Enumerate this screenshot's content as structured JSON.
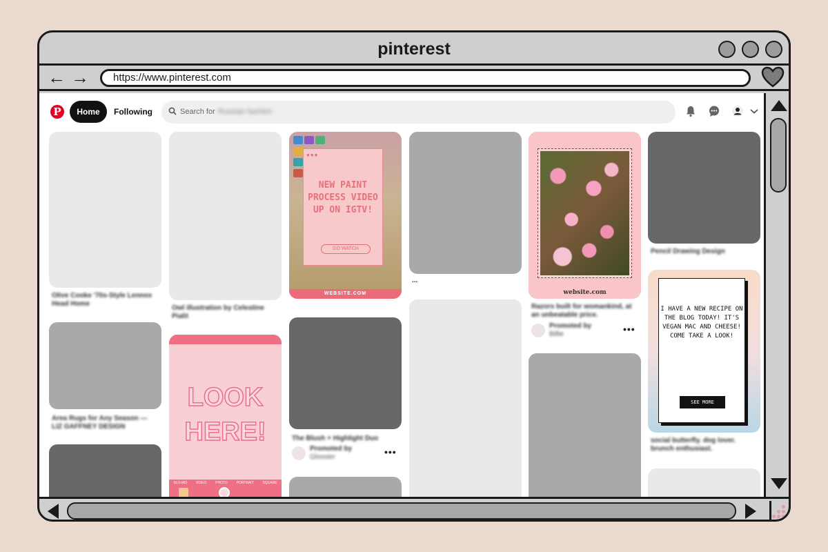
{
  "window": {
    "title": "pinterest",
    "url": "https://www.pinterest.com"
  },
  "header": {
    "logo": "P",
    "home_label": "Home",
    "following_label": "Following",
    "search_placeholder": "Search for",
    "search_query": "Russian fashion"
  },
  "pins": {
    "paint": {
      "dots": "●●●",
      "text": "NEW PAINT PROCESS VIDEO UP ON IGTV!",
      "button": "GO WATCH",
      "footer": "WEBSITE.COM"
    },
    "flowers": {
      "web_label": "website.com",
      "caption": "Razors built for womankind, at an unbeatable price.",
      "promoted_label": "Promoted by",
      "promoter": "Billie"
    },
    "look": {
      "text": "LOOK HERE!",
      "modes": [
        "SLO-MO",
        "VIDEO",
        "PHOTO",
        "PORTRAIT",
        "SQUARE"
      ]
    },
    "recipe": {
      "text": "I HAVE A NEW RECIPE ON THE BLOG TODAY! IT'S VEGAN MAC AND CHEESE! COME TAKE A LOOK!",
      "button": "SEE MORE",
      "caption": "social butterfly. dog lover. brunch enthusiast."
    },
    "blush": {
      "caption": "The Blush + Highlight Duo",
      "promoted_label": "Promoted by",
      "promoter": "Glossier"
    },
    "captions": {
      "col1_a": "Olive Cooke '70s-Style Lennox Head Home",
      "col1_b": "Area Rugs for Any Season — LIZ GAFFNEY DESIGN",
      "col2_a": "Owl illustration by Celestine Pialit",
      "col4_a": "...",
      "col6_a": "Pencil Drawing Design"
    }
  },
  "more_dots": "•••"
}
